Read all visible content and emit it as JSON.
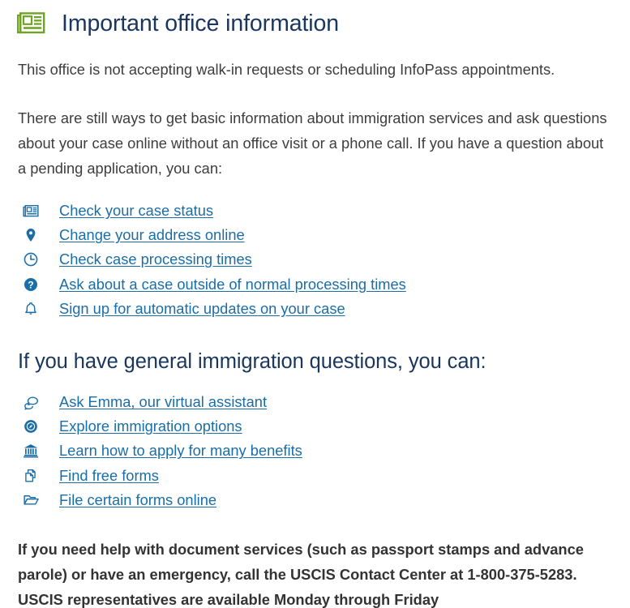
{
  "header": {
    "icon": "newspaper-icon",
    "icon_color": "#6fa325",
    "title": "Important office information"
  },
  "colors": {
    "heading": "#19365e",
    "link": "#1a6ea8",
    "body_text": "#3d3d3d",
    "accent_green": "#6fa325",
    "background": "#ffffff"
  },
  "paragraphs": {
    "intro": "This office is not accepting walk-in requests or scheduling InfoPass appointments.",
    "second": "There are still ways to get basic information about immigration services and ask questions about your case online without an office visit or a phone call. If you have a question about a pending application, you can:",
    "contact_bold": "If you need help with document services (such as passport stamps and advance parole) or have an emergency, call the USCIS Contact Center at 1-800-375-5283. USCIS representatives are available Monday through Friday"
  },
  "case_links": [
    {
      "icon": "newspaper-icon",
      "label": "Check your case status"
    },
    {
      "icon": "map-pin-icon",
      "label": "Change your address online"
    },
    {
      "icon": "clock-icon",
      "label": "Check case processing times"
    },
    {
      "icon": "question-circle-icon",
      "label": "Ask about a case outside of normal processing times"
    },
    {
      "icon": "bell-icon",
      "label": "Sign up for automatic updates on your case"
    }
  ],
  "general_section": {
    "heading": "If you have general immigration questions, you can:",
    "links": [
      {
        "icon": "chat-bubbles-icon",
        "label": "Ask Emma, our virtual assistant"
      },
      {
        "icon": "compass-icon",
        "label": "Explore immigration options"
      },
      {
        "icon": "bank-building-icon",
        "label": "Learn how to apply for many benefits"
      },
      {
        "icon": "copy-documents-icon",
        "label": "Find free forms"
      },
      {
        "icon": "open-folder-icon",
        "label": "File certain forms online"
      }
    ]
  }
}
